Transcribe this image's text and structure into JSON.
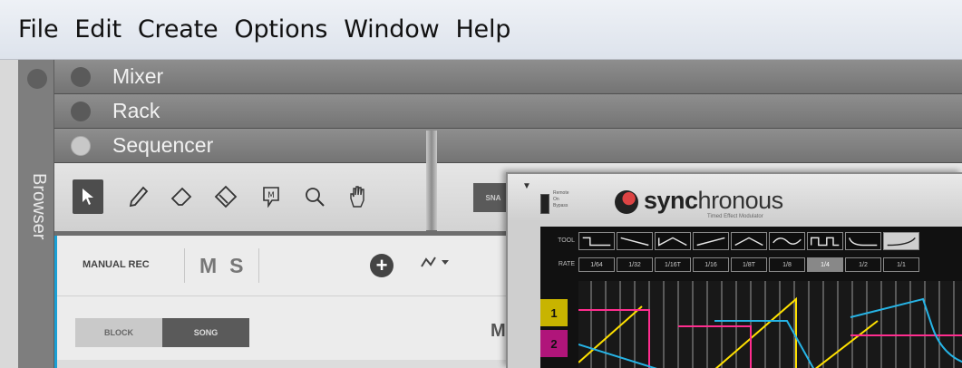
{
  "menu": {
    "items": [
      "File",
      "Edit",
      "Create",
      "Options",
      "Window",
      "Help"
    ]
  },
  "browser": {
    "label": "Browser"
  },
  "panels": [
    {
      "title": "Mixer",
      "active": false
    },
    {
      "title": "Rack",
      "active": false
    },
    {
      "title": "Sequencer",
      "active": true
    }
  ],
  "sequencer": {
    "tools": [
      "select-arrow",
      "pencil",
      "eraser",
      "razor",
      "mute",
      "magnify",
      "hand"
    ],
    "snap_label": "SNA",
    "manual_rec_label": "MANUAL REC",
    "mute_label": "M",
    "solo_label": "S",
    "block_label": "BLOCK",
    "song_label": "SONG",
    "truncated_label": "M"
  },
  "plugin": {
    "brand_bold": "sync",
    "brand_rest": "hronous",
    "tagline": "Timed Effect Modulator",
    "switch_labels": [
      "Remote",
      "On",
      "Bypass"
    ],
    "tool_label": "TOOL",
    "rate_label": "RATE",
    "rates": [
      "1/64",
      "1/32",
      "1/16T",
      "1/16",
      "1/8T",
      "1/8",
      "1/4",
      "1/2",
      "1/1"
    ],
    "selected_rate_index": 6,
    "selected_tool_index": 8,
    "lanes": [
      {
        "label": "1",
        "color": "#c8b400"
      },
      {
        "label": "2",
        "color": "#b0157a"
      }
    ],
    "curve_colors": [
      "#ffe100",
      "#ff2d8e",
      "#26b4e6"
    ]
  },
  "colors": {
    "accent": "#1aa0d5",
    "panel_bar": "#808080"
  }
}
